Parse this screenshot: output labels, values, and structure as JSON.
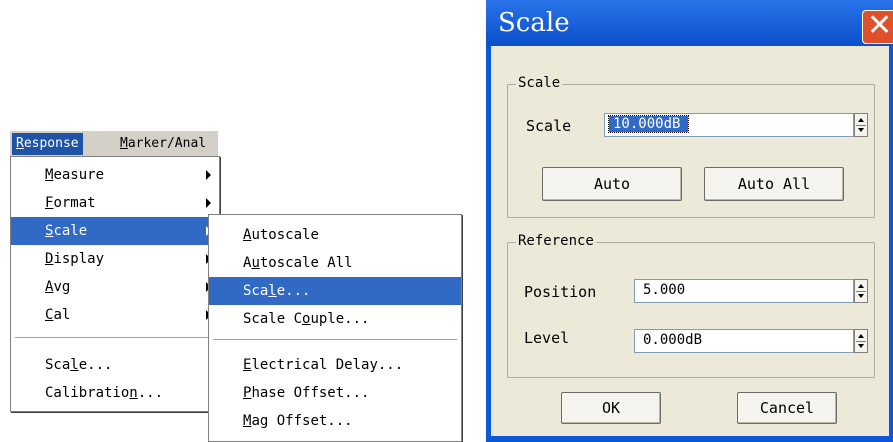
{
  "menubar": {
    "items": [
      "Response",
      "Marker/Anal"
    ]
  },
  "response_menu": {
    "items": [
      {
        "label": "Measure",
        "underline": "M"
      },
      {
        "label": "Format",
        "underline": "F"
      },
      {
        "label": "Scale",
        "underline": "S"
      },
      {
        "label": "Display",
        "underline": "D"
      },
      {
        "label": "Avg",
        "underline": "A"
      },
      {
        "label": "Cal",
        "underline": "C"
      },
      {
        "label": "Scale...",
        "underline": "l"
      },
      {
        "label": "Calibration...",
        "underline": "n"
      }
    ],
    "selected": "Scale"
  },
  "scale_submenu": {
    "items": [
      "Autoscale",
      "Autoscale All",
      "Scale...",
      "Scale Couple...",
      "Electrical Delay...",
      "Phase Offset...",
      "Mag Offset..."
    ],
    "selected": "Scale..."
  },
  "dialog": {
    "title": "Scale",
    "scale_group": {
      "label": "Scale",
      "field_label": "Scale",
      "value": "10.000dB",
      "auto": "Auto",
      "auto_all": "Auto All"
    },
    "reference_group": {
      "label": "Reference",
      "position_label": "Position",
      "position_value": "5.000",
      "level_label": "Level",
      "level_value": "0.000dB"
    },
    "ok": "OK",
    "cancel": "Cancel"
  },
  "colors": {
    "selection": "#316ac5",
    "title_bar": "#0a4fcc",
    "dialog_bg": "#ece9d8",
    "close_button": "#e0502b"
  }
}
